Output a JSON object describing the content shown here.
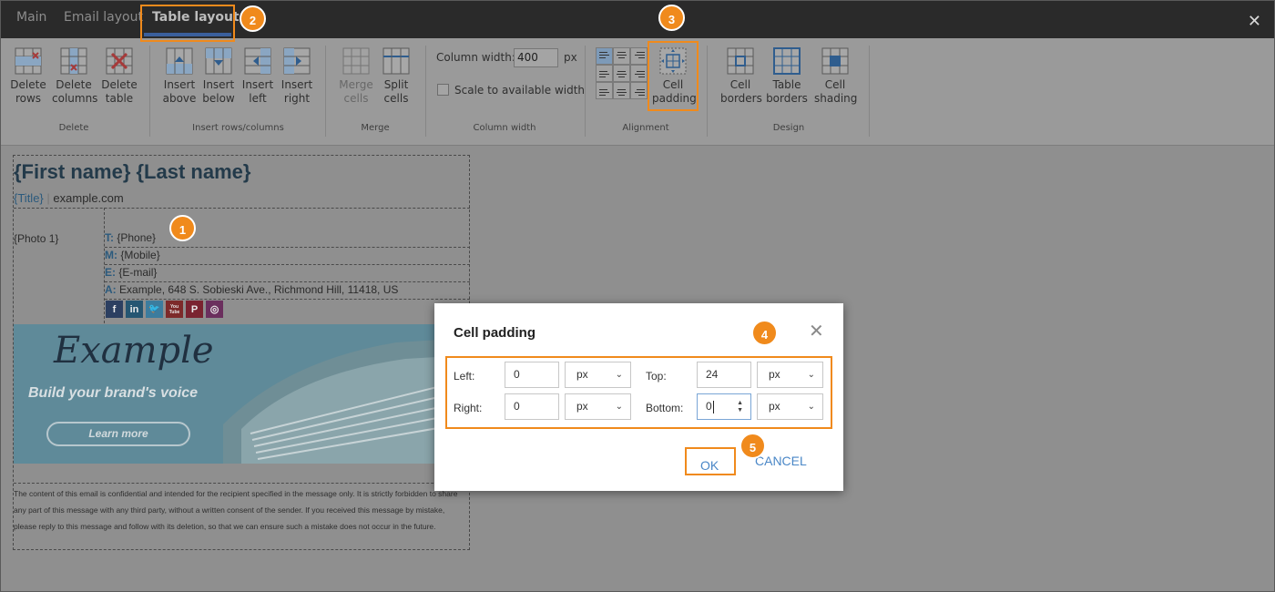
{
  "tabs": [
    "Main",
    "Email layout",
    "Table layout"
  ],
  "ribbon": {
    "delete_group": "Delete",
    "delete_rows": [
      "Delete",
      "rows"
    ],
    "delete_columns": [
      "Delete",
      "columns"
    ],
    "delete_table": [
      "Delete",
      "table"
    ],
    "insert_group": "Insert rows/columns",
    "insert_above": [
      "Insert",
      "above"
    ],
    "insert_below": [
      "Insert",
      "below"
    ],
    "insert_left": [
      "Insert",
      "left"
    ],
    "insert_right": [
      "Insert",
      "right"
    ],
    "merge_group": "Merge",
    "merge_cells": [
      "Merge",
      "cells"
    ],
    "split_cells": [
      "Split",
      "cells"
    ],
    "column_width_group": "Column width",
    "column_width_label": "Column width:",
    "column_width_value": "400",
    "column_width_unit": "px",
    "scale_label": "Scale to available width",
    "alignment_group": "Alignment",
    "cell_padding": [
      "Cell",
      "padding"
    ],
    "design_group": "Design",
    "cell_borders": [
      "Cell",
      "borders"
    ],
    "table_borders": [
      "Table",
      "borders"
    ],
    "cell_shading": [
      "Cell",
      "shading"
    ]
  },
  "signature": {
    "name": "{First name} {Last name}",
    "title": "{Title}",
    "separator": "|",
    "website": "example.com",
    "photo": "{Photo 1}",
    "contacts": [
      {
        "label": "T:",
        "value": "{Phone}"
      },
      {
        "label": "M:",
        "value": "{Mobile}"
      },
      {
        "label": "E:",
        "value": "{E-mail}"
      },
      {
        "label": "A:",
        "value": "Example, 648 S. Sobieski Ave., Richmond Hill, 11418, US"
      }
    ],
    "social": [
      "f",
      "in",
      "t",
      "You Tube",
      "P",
      "ig"
    ],
    "banner_title": "Example",
    "banner_tagline": "Build your brand's voice",
    "banner_button": "Learn more",
    "disclaimer": "The content of this email is confidential and intended for the recipient specified in the message only. It is strictly forbidden to share any part of this message with any third party, without a written consent of the sender. If you received this message by mistake, please reply to this message and follow with its deletion, so that we can ensure such a mistake does not occur in the future."
  },
  "dialog": {
    "title": "Cell padding",
    "left_label": "Left:",
    "left_value": "0",
    "left_unit": "px",
    "top_label": "Top:",
    "top_value": "24",
    "top_unit": "px",
    "right_label": "Right:",
    "right_value": "0",
    "right_unit": "px",
    "bottom_label": "Bottom:",
    "bottom_value": "0",
    "bottom_unit": "px",
    "ok": "OK",
    "cancel": "CANCEL"
  },
  "callouts": [
    "1",
    "2",
    "3",
    "4",
    "5"
  ],
  "colors": {
    "accent": "#f08a1c",
    "link": "#4a87c7",
    "tabbar": "#2a2a2a",
    "tab_underline": "#3a5f9c"
  }
}
